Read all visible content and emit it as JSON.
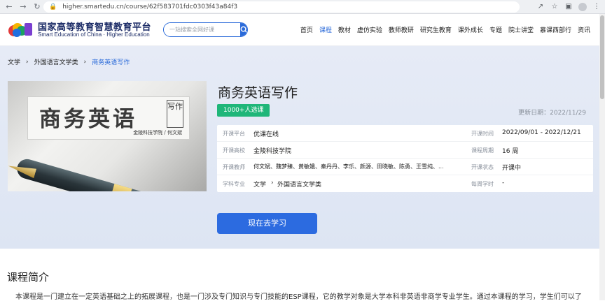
{
  "browser": {
    "url": "higher.smartedu.cn/course/62f583701fdc0303f43a84f3",
    "icons": [
      "back-icon",
      "forward-icon",
      "reload-icon",
      "lock-icon",
      "share-icon",
      "star-icon",
      "sidebar-icon",
      "profile-icon",
      "menu-icon"
    ]
  },
  "header": {
    "logo_cn": "国家高等教育智慧教育平台",
    "logo_en": "Smart Education of China · Higher Education",
    "search_placeholder": "一站搜索全网好课",
    "nav": [
      {
        "label": "首页",
        "active": false
      },
      {
        "label": "课程",
        "active": true
      },
      {
        "label": "教材",
        "active": false
      },
      {
        "label": "虚仿实验",
        "active": false
      },
      {
        "label": "教师教研",
        "active": false
      },
      {
        "label": "研究生教育",
        "active": false
      },
      {
        "label": "课外成长",
        "active": false
      },
      {
        "label": "专题",
        "active": false
      },
      {
        "label": "院士讲堂",
        "active": false
      },
      {
        "label": "慕课西部行",
        "active": false
      },
      {
        "label": "资讯",
        "active": false
      }
    ]
  },
  "breadcrumb": {
    "level1": "文学",
    "level2": "外国语言文学类",
    "current": "商务英语写作"
  },
  "cover": {
    "title": "商务英语",
    "badge": "写作",
    "author": "金陵科技学院 / 何文斌"
  },
  "course": {
    "title": "商务英语写作",
    "enroll": "1000+人选课",
    "update_date": "更新日期：2022/11/29",
    "info": {
      "platform_label": "开课平台",
      "platform": "优课在线",
      "time_label": "开课时间",
      "time": "2022/09/01 - 2022/12/21",
      "school_label": "开课高校",
      "school": "金陵科技学院",
      "period_label": "课程周期",
      "period": "16 周",
      "teachers_label": "开课教师",
      "teachers": "何文斌、魏梦臻、黄敏娥、秦丹丹、李乐、颜源、田晓敏、陈勇、王雪纯、...",
      "status_label": "开课状态",
      "status": "开课中",
      "subject_label": "学科专业",
      "subject1": "文学",
      "subject2": "外国语言文学类",
      "hours_label": "每周学时",
      "hours": "-"
    },
    "study_button": "现在去学习"
  },
  "intro": {
    "heading": "课程简介",
    "text": "本课程是一门建立在一定英语基础之上的拓展课程，也是一门涉及专门知识与专门技能的ESP课程，它的教学对象是大学本科非英语非商学专业学生。通过本课程的学习，学生们可以了"
  },
  "colors": {
    "accent": "#2a6ad9",
    "badge_green": "#1fb679",
    "hero_bg": "#e2e8f5"
  }
}
